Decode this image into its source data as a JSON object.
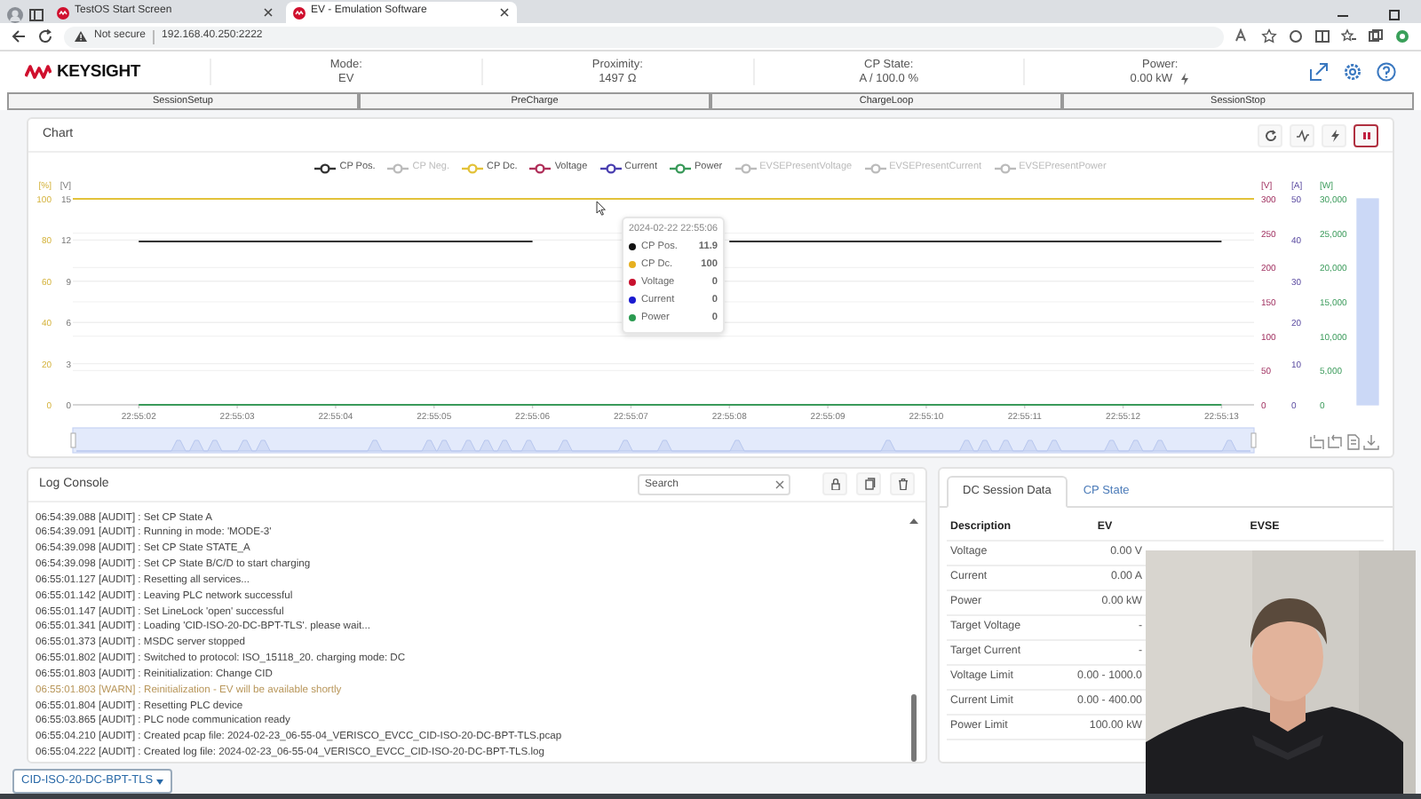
{
  "browser": {
    "tabs": [
      {
        "title": "TestOS Start Screen",
        "selected": false
      },
      {
        "title": "EV - Emulation Software",
        "selected": true
      }
    ],
    "address": {
      "security": "Not secure",
      "url": "192.168.40.250:2222"
    }
  },
  "header": {
    "logo": "KEYSIGHT",
    "stats": [
      {
        "label": "Mode:",
        "value": "EV",
        "kind": "plain"
      },
      {
        "label": "Proximity:",
        "value": "1497 Ω",
        "kind": "plain"
      },
      {
        "label": "CP State:",
        "value": "A / 100.0 %",
        "kind": "plain"
      },
      {
        "label": "Power:",
        "value": "0.00 kW",
        "kind": "power"
      }
    ]
  },
  "stages": [
    "SessionSetup",
    "PreCharge",
    "ChargeLoop",
    "SessionStop"
  ],
  "chart": {
    "title": "Chart",
    "paused": true,
    "legend": [
      {
        "kind": "series",
        "on": true
      },
      {
        "kind": "extra",
        "name": "CP Neg.",
        "color": "#bbbbbb",
        "on": false
      },
      {
        "kind": "top_line",
        "name": "CP Dc.",
        "color": "#e3c23a",
        "on": true
      },
      {
        "kind": "extra",
        "name": "Voltage",
        "color": "#b0305a",
        "on": true
      },
      {
        "kind": "extra",
        "name": "Current",
        "color": "#4a3fb0",
        "on": true
      },
      {
        "kind": "series",
        "on": true
      },
      {
        "kind": "extra",
        "name": "EVSEPresentVoltage",
        "color": "#bbbbbb",
        "on": false
      },
      {
        "kind": "extra",
        "name": "EVSEPresentCurrent",
        "color": "#bbbbbb",
        "on": false
      },
      {
        "kind": "extra",
        "name": "EVSEPresentPower",
        "color": "#bbbbbb",
        "on": false
      }
    ],
    "axes": [
      {
        "unit": "[%]",
        "ticks": [
          "100",
          "80",
          "60",
          "40",
          "20",
          "0"
        ]
      },
      {
        "unit": "[V]",
        "ticks": [
          "300",
          "250",
          "200",
          "150",
          "100",
          "50",
          "0"
        ]
      },
      {
        "unit": "[A]",
        "ticks": [
          "50",
          "40",
          "30",
          "20",
          "10",
          "0"
        ]
      },
      {
        "unit": "[W]",
        "ticks": [
          "30,000",
          "25,000",
          "20,000",
          "15,000",
          "10,000",
          "5,000",
          "0"
        ]
      }
    ],
    "range_slider": {
      "level": 1
    },
    "chart_data": {
      "type": "line",
      "ylabel": "[V]",
      "x": [
        "22:55:02",
        "22:55:03",
        "22:55:04",
        "22:55:05",
        "22:55:06",
        "22:55:07",
        "22:55:08",
        "22:55:09",
        "22:55:10",
        "22:55:11",
        "22:55:12",
        "22:55:13"
      ],
      "ylim": [
        0,
        15
      ],
      "yticks": [
        0,
        3,
        6,
        9,
        12,
        15
      ],
      "grid": true,
      "series": [
        {
          "name": "CP Pos.",
          "color": "#333333",
          "values": [
            11.9,
            11.9,
            11.9,
            11.9,
            11.9,
            null,
            11.9,
            11.9,
            11.9,
            11.9,
            11.9,
            11.9
          ]
        },
        {
          "name": "Power",
          "color": "#3a9a5a",
          "values": [
            0,
            0,
            0,
            0,
            0,
            0,
            0,
            0,
            0,
            0,
            0,
            0
          ]
        }
      ]
    },
    "tooltip": {
      "title": "2024-02-22 22:55:06",
      "rows": [
        {
          "label": "CP Pos.",
          "value": "11.9",
          "color": "#111111"
        },
        {
          "label": "CP Dc.",
          "value": "100",
          "color": "#e6b020"
        },
        {
          "label": "Voltage",
          "value": "0",
          "color": "#c8102e"
        },
        {
          "label": "Current",
          "value": "0",
          "color": "#1a1ad0"
        },
        {
          "label": "Power",
          "value": "0",
          "color": "#2a9a50"
        }
      ]
    }
  },
  "log_console": {
    "title": "Log Console",
    "search": {
      "placeholder": "Search"
    },
    "lines": [
      {
        "text": "06:54:39.088 [AUDIT] : Set CP State A",
        "kind": "audit"
      },
      {
        "text": "06:54:39.091 [AUDIT] : Running in mode: 'MODE-3'",
        "kind": "audit"
      },
      {
        "text": "06:54:39.098 [AUDIT] : Set CP State STATE_A",
        "kind": "audit"
      },
      {
        "text": "06:54:39.098 [AUDIT] : Set CP State B/C/D to start charging",
        "kind": "audit"
      },
      {
        "text": "06:55:01.127 [AUDIT] : Resetting all services...",
        "kind": "audit"
      },
      {
        "text": "06:55:01.142 [AUDIT] : Leaving PLC network successful",
        "kind": "audit"
      },
      {
        "text": "06:55:01.147 [AUDIT] : Set LineLock 'open' successful",
        "kind": "audit"
      },
      {
        "text": "06:55:01.341 [AUDIT] : Loading 'CID-ISO-20-DC-BPT-TLS'. please wait...",
        "kind": "audit"
      },
      {
        "text": "06:55:01.373 [AUDIT] : MSDC server stopped",
        "kind": "audit"
      },
      {
        "text": "06:55:01.802 [AUDIT] : Switched to protocol: ISO_15118_20. charging mode: DC",
        "kind": "audit"
      },
      {
        "text": "06:55:01.803 [AUDIT] : Reinitialization: Change CID",
        "kind": "audit"
      },
      {
        "text": "06:55:01.803 [WARN] : Reinitialization - EV will be available shortly",
        "kind": "warn"
      },
      {
        "text": "06:55:01.804 [AUDIT] : Resetting PLC device",
        "kind": "audit"
      },
      {
        "text": "06:55:03.865 [AUDIT] : PLC node communication ready",
        "kind": "audit"
      },
      {
        "text": "06:55:04.210 [AUDIT] : Created pcap file: 2024-02-23_06-55-04_VERISCO_EVCC_CID-ISO-20-DC-BPT-TLS.pcap",
        "kind": "audit"
      },
      {
        "text": "06:55:04.222 [AUDIT] : Created log file: 2024-02-23_06-55-04_VERISCO_EVCC_CID-ISO-20-DC-BPT-TLS.log",
        "kind": "audit"
      }
    ]
  },
  "session": {
    "tabs": [
      {
        "label": "DC Session Data",
        "selected": true
      },
      {
        "label": "CP State",
        "selected": false
      }
    ],
    "columns": [
      "Description",
      "EV",
      "EVSE"
    ],
    "rows": [
      {
        "description": "Voltage",
        "ev": "0.00 V"
      },
      {
        "description": "Current",
        "ev": "0.00 A"
      },
      {
        "description": "Power",
        "ev": "0.00 kW"
      },
      {
        "description": "Target Voltage",
        "ev": "-"
      },
      {
        "description": "Target Current",
        "ev": "-"
      },
      {
        "description": "Voltage Limit",
        "ev": "0.00 - 1000.0"
      },
      {
        "description": "Current Limit",
        "ev": "0.00 - 400.00"
      },
      {
        "description": "Power Limit",
        "ev": "100.00 kW"
      }
    ]
  },
  "webcam": {
    "kind": "picture"
  },
  "profile_dropdown": {
    "label": "CID-ISO-20-DC-BPT-TLS"
  }
}
